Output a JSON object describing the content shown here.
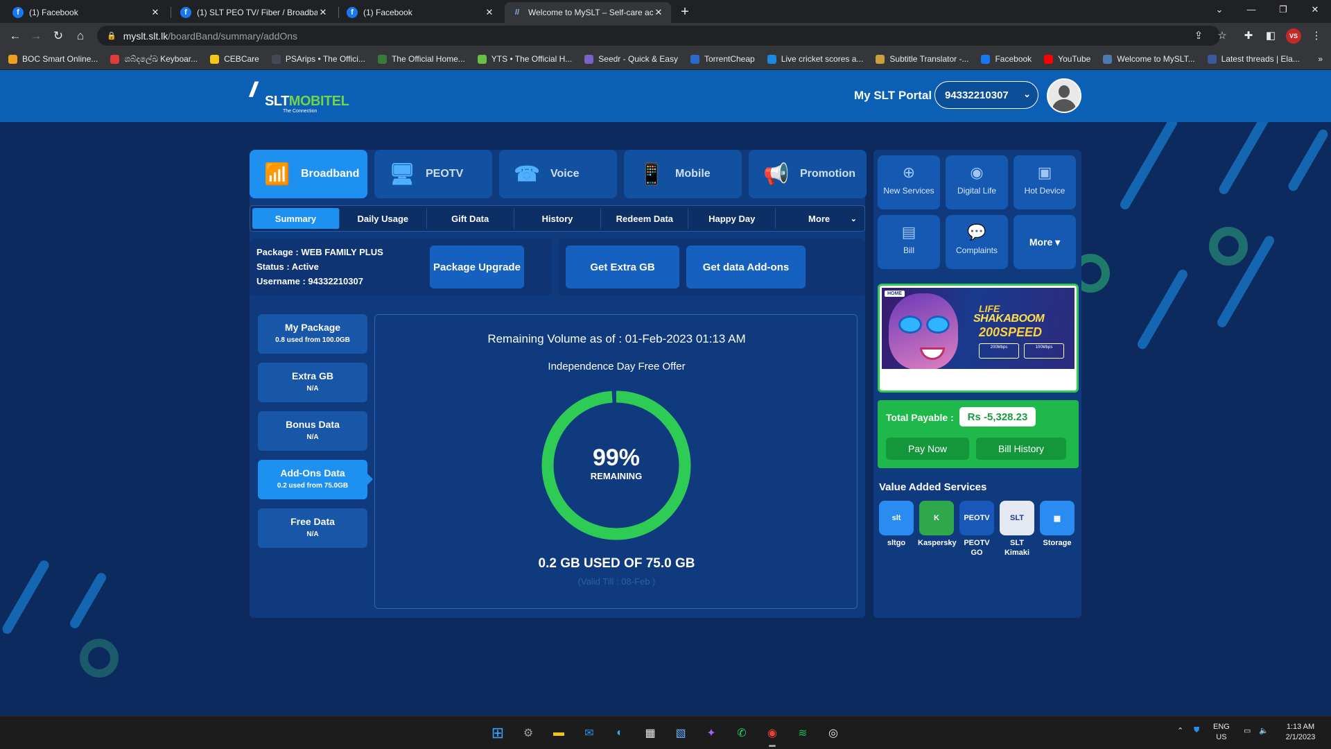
{
  "browser": {
    "tabs": [
      {
        "title": "(1) Facebook",
        "icon": "facebook-icon"
      },
      {
        "title": "(1) SLT PEO TV/ Fiber / Broadban",
        "icon": "facebook-icon"
      },
      {
        "title": "(1) Facebook",
        "icon": "facebook-icon"
      },
      {
        "title": "Welcome to MySLT – Self-care ac",
        "icon": "slt-icon"
      }
    ],
    "new_tab": "+",
    "url_host": "myslt.slt.lk",
    "url_path": "/boardBand/summary/addOns",
    "bookmarks": [
      {
        "label": "BOC Smart Online...",
        "color": "#f0a020"
      },
      {
        "label": "ශබ්දලේඛ Keyboar...",
        "color": "#e03a3a"
      },
      {
        "label": "CEBCare",
        "color": "#f5c518"
      },
      {
        "label": "PSArips • The Offici...",
        "color": "#444a55"
      },
      {
        "label": "The Official Home...",
        "color": "#3a7a3a"
      },
      {
        "label": "YTS • The Official H...",
        "color": "#6ac045"
      },
      {
        "label": "Seedr - Quick & Easy",
        "color": "#7a62c9"
      },
      {
        "label": "TorrentCheap",
        "color": "#2a6acb"
      },
      {
        "label": "Live cricket scores a...",
        "color": "#1a8ae0"
      },
      {
        "label": "Subtitle Translator -...",
        "color": "#c9a040"
      },
      {
        "label": "Facebook",
        "color": "#1877f2"
      },
      {
        "label": "YouTube",
        "color": "#ff0000"
      },
      {
        "label": "Welcome to MySLT...",
        "color": "#4a7ab0"
      },
      {
        "label": "Latest threads | Ela...",
        "color": "#3a5a9a"
      }
    ],
    "bookmarks_more": "»"
  },
  "header": {
    "logo_mark": "//",
    "logo_part1": "SLT",
    "logo_part2": "MOBITEL",
    "logo_tagline": "The Connection",
    "portal_title": "My SLT Portal",
    "account_number": "94332210307"
  },
  "service_tabs": [
    {
      "label": "Broadband",
      "icon": "wifi-router-icon",
      "glyph": "📶"
    },
    {
      "label": "PEOTV",
      "icon": "tv-icon",
      "glyph": "🖥"
    },
    {
      "label": "Voice",
      "icon": "phone-icon",
      "glyph": "☎"
    },
    {
      "label": "Mobile",
      "icon": "mobile-icon",
      "glyph": "📱"
    },
    {
      "label": "Promotion",
      "icon": "megaphone-icon",
      "glyph": "📢"
    }
  ],
  "sub_tabs": [
    "Summary",
    "Daily Usage",
    "Gift Data",
    "History",
    "Redeem Data",
    "Happy Day",
    "More"
  ],
  "package": {
    "package_line": "Package : WEB FAMILY PLUS",
    "status_line": "Status : Active",
    "username_line": "Username : 94332210307",
    "upgrade_button": "Package Upgrade",
    "extra_gb_button": "Get Extra GB",
    "addons_button": "Get data Add-ons"
  },
  "usage_cards": [
    {
      "title": "My Package",
      "sub": "0.8 used from 100.0GB"
    },
    {
      "title": "Extra GB",
      "sub": "N/A"
    },
    {
      "title": "Bonus Data",
      "sub": "N/A"
    },
    {
      "title": "Add-Ons Data",
      "sub": "0.2 used from 75.0GB"
    },
    {
      "title": "Free Data",
      "sub": "N/A"
    }
  ],
  "gauge": {
    "title": "Remaining Volume as of : 01-Feb-2023 01:13 AM",
    "offer": "Independence Day Free Offer",
    "percent_text": "99%",
    "remaining_label": "REMAINING",
    "remaining_fraction": 0.99,
    "used_text": "0.2 GB USED OF 75.0 GB",
    "valid_text": "(Valid Till : 08-Feb )",
    "ring_color": "#2ecc55"
  },
  "quick_links": [
    {
      "label": "New Services",
      "icon": "new-services-icon",
      "glyph": "⊕"
    },
    {
      "label": "Digital Life",
      "icon": "digital-life-icon",
      "glyph": "◉"
    },
    {
      "label": "Hot Device",
      "icon": "hot-device-icon",
      "glyph": "▣"
    },
    {
      "label": "Bill",
      "icon": "bill-icon",
      "glyph": "▤"
    },
    {
      "label": "Complaints",
      "icon": "complaints-icon",
      "glyph": "💬"
    },
    {
      "label": "More ▾",
      "icon": "chevron-down-icon",
      "glyph": ""
    }
  ],
  "banner": {
    "home_tag": "HOME",
    "line1": "LIFE",
    "line2": "SHAKABOOM",
    "line3": "200SPEED",
    "box1": "200Mbps",
    "box2": "100Mbps"
  },
  "billing": {
    "total_label": "Total Payable :",
    "amount": "Rs -5,328.23",
    "pay_now": "Pay Now",
    "bill_history": "Bill History"
  },
  "vas": {
    "title": "Value Added Services",
    "items": [
      {
        "label": "sltgo",
        "short": "slt",
        "color": "#2a8cf0"
      },
      {
        "label": "Kaspersky",
        "short": "K",
        "color": "#2ea84a"
      },
      {
        "label": "PEOTV GO",
        "short": "PEOTV",
        "color": "#1758b8"
      },
      {
        "label": "SLT Kimaki",
        "short": "SLT",
        "color": "#e4e8f0"
      },
      {
        "label": "Storage",
        "short": "▦",
        "color": "#2a8cf0"
      }
    ]
  },
  "taskbar": {
    "lang": "ENG",
    "region": "US",
    "time": "1:13 AM",
    "date": "2/1/2023"
  }
}
